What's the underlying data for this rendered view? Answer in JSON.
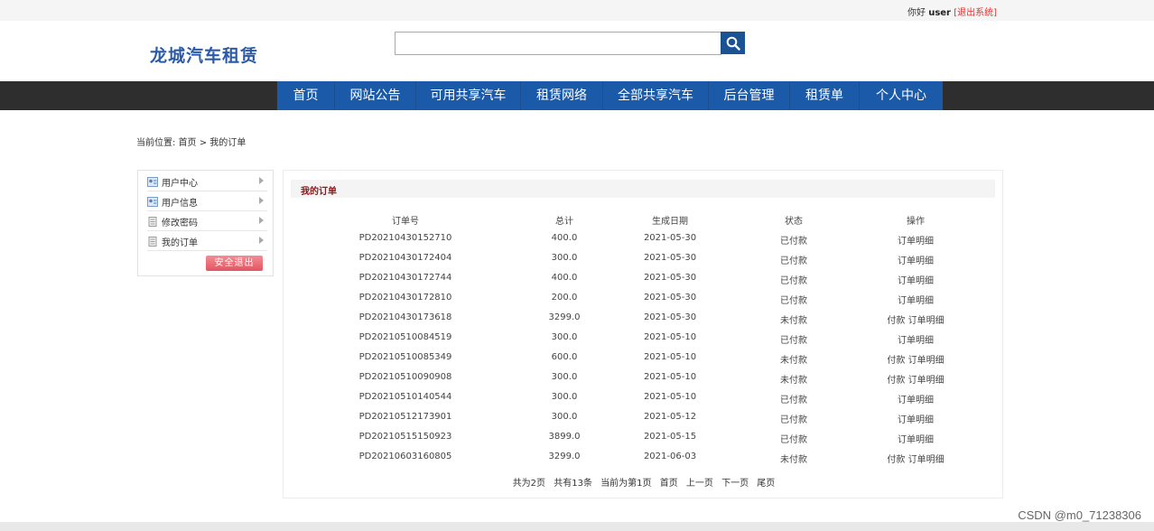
{
  "topbar": {
    "greeting": "你好",
    "username": "user",
    "logout_link": "[退出系统]"
  },
  "logo": "龙城汽车租赁",
  "search": {
    "placeholder": "",
    "value": ""
  },
  "nav": [
    "首页",
    "网站公告",
    "可用共享汽车",
    "租赁网络",
    "全部共享汽车",
    "后台管理",
    "租赁单",
    "个人中心"
  ],
  "breadcrumb": "当前位置: 首页 > 我的订单",
  "sidebar": {
    "items": [
      "用户中心",
      "用户信息",
      "修改密码",
      "我的订单"
    ],
    "logout_button": "安全退出"
  },
  "orders": {
    "title": "我的订单",
    "columns": [
      "订单号",
      "总计",
      "生成日期",
      "状态",
      "操作"
    ],
    "rows": [
      [
        "PD20210430152710",
        "400.0",
        "2021-05-30",
        "已付款",
        "订单明细"
      ],
      [
        "PD20210430172404",
        "300.0",
        "2021-05-30",
        "已付款",
        "订单明细"
      ],
      [
        "PD20210430172744",
        "400.0",
        "2021-05-30",
        "已付款",
        "订单明细"
      ],
      [
        "PD20210430172810",
        "200.0",
        "2021-05-30",
        "已付款",
        "订单明细"
      ],
      [
        "PD20210430173618",
        "3299.0",
        "2021-05-30",
        "未付款",
        "付款 订单明细"
      ],
      [
        "PD20210510084519",
        "300.0",
        "2021-05-10",
        "已付款",
        "订单明细"
      ],
      [
        "PD20210510085349",
        "600.0",
        "2021-05-10",
        "未付款",
        "付款 订单明细"
      ],
      [
        "PD20210510090908",
        "300.0",
        "2021-05-10",
        "未付款",
        "付款 订单明细"
      ],
      [
        "PD20210510140544",
        "300.0",
        "2021-05-10",
        "已付款",
        "订单明细"
      ],
      [
        "PD20210512173901",
        "300.0",
        "2021-05-12",
        "已付款",
        "订单明细"
      ],
      [
        "PD20210515150923",
        "3899.0",
        "2021-05-15",
        "已付款",
        "订单明细"
      ],
      [
        "PD20210603160805",
        "3299.0",
        "2021-06-03",
        "未付款",
        "付款 订单明细"
      ]
    ],
    "pager": {
      "total_pages": "共为2页",
      "total_items": "共有13条",
      "current": "当前为第1页",
      "first": "首页",
      "prev": "上一页",
      "next": "下一页",
      "last": "尾页"
    }
  },
  "watermark": "CSDN @m0_71238306",
  "colors": {
    "nav_blue": "#1a5aa8",
    "nav_band": "#2e2e2e",
    "title_red": "#8b1a1a",
    "logout_pink": "#e25562"
  },
  "icons": {
    "search": "magnifier-icon",
    "sidebar": "id-card-icon"
  }
}
